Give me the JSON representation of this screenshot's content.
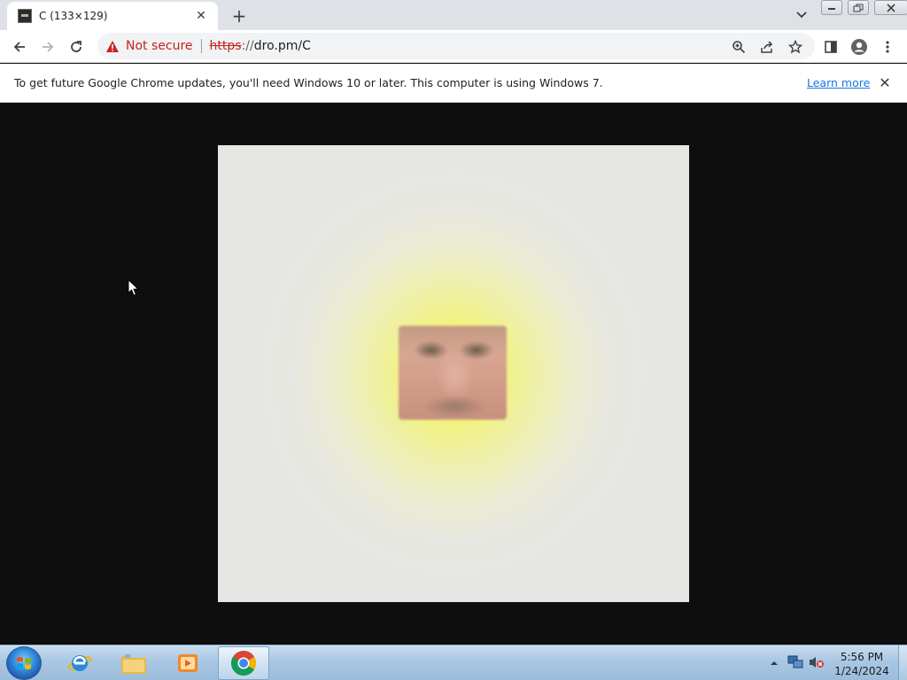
{
  "browser": {
    "tab": {
      "title": "C (133×129)",
      "favicon": "image-favicon"
    },
    "new_tab_label": "+",
    "omnibox": {
      "security_label": "Not secure",
      "url_scheme": "https",
      "url_rest": "://",
      "url_host": "dro.pm/C"
    },
    "toolbar_icons": [
      "back-icon",
      "forward-icon",
      "reload-icon",
      "zoom-icon",
      "share-icon",
      "bookmark-star-icon",
      "side-panel-icon",
      "profile-icon",
      "menu-icon"
    ]
  },
  "infobar": {
    "message": "To get future Google Chrome updates, you'll need Windows 10 or later. This computer is using Windows 7.",
    "link": "Learn more",
    "close_icon": "close-icon"
  },
  "content": {
    "image_description": "blurred face image",
    "colors": {
      "glow": "#f4f45a",
      "background": "#e6e6e4",
      "viewport": "#0e0e0e"
    }
  },
  "taskbar": {
    "clock_time": "5:56 PM",
    "clock_date": "1/24/2024",
    "pinned": [
      "start-orb-icon",
      "internet-explorer-icon",
      "file-explorer-icon",
      "media-player-icon",
      "chrome-icon"
    ]
  }
}
